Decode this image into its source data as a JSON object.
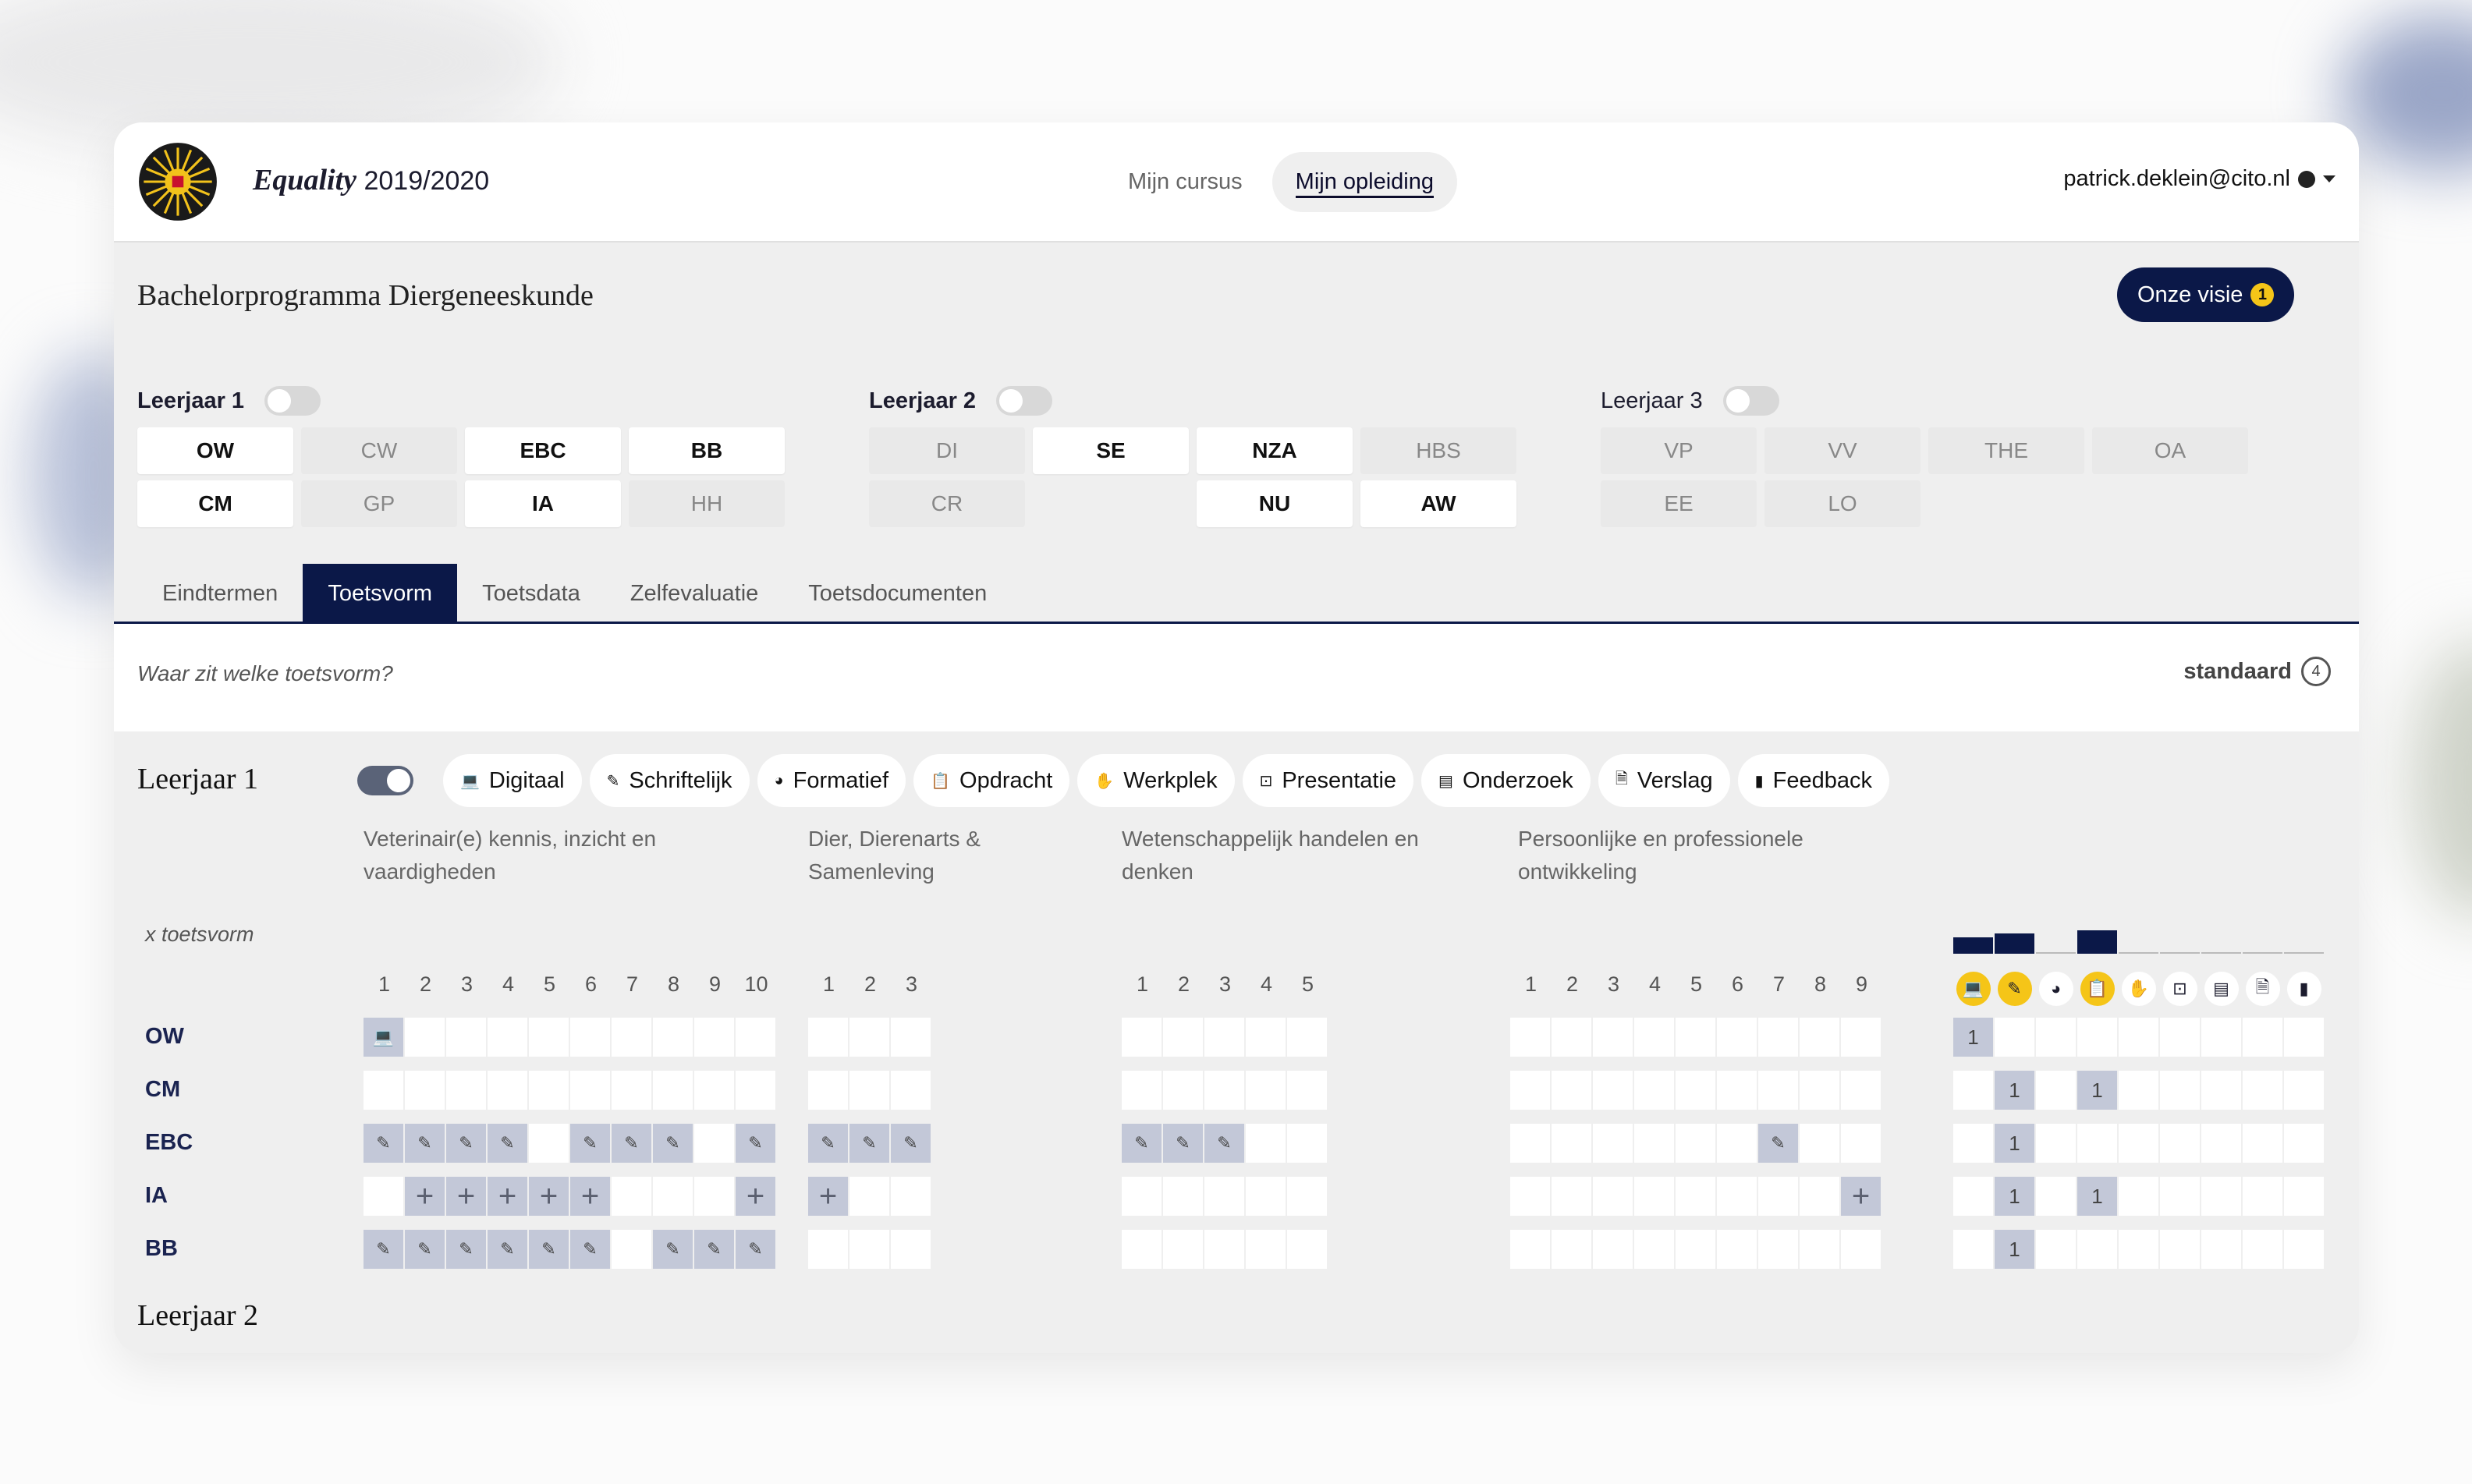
{
  "header": {
    "app_name": "Equality",
    "year": "2019/2020",
    "nav": [
      "Mijn cursus",
      "Mijn opleiding"
    ],
    "user": "patrick.deklein@cito.nl"
  },
  "program": {
    "title": "Bachelorprogramma Diergeneeskunde",
    "vision_label": "Onze visie",
    "vision_badge": "1"
  },
  "years": [
    {
      "label": "Leerjaar 1",
      "courses": [
        [
          "OW",
          "on"
        ],
        [
          "CW",
          "off"
        ],
        [
          "EBC",
          "on"
        ],
        [
          "BB",
          "on"
        ],
        [
          "CM",
          "on"
        ],
        [
          "GP",
          "off"
        ],
        [
          "IA",
          "on"
        ],
        [
          "HH",
          "off"
        ]
      ]
    },
    {
      "label": "Leerjaar 2",
      "courses": [
        [
          "DI",
          "off"
        ],
        [
          "SE",
          "on"
        ],
        [
          "NZA",
          "on"
        ],
        [
          "HBS",
          "off"
        ],
        [
          "CR",
          "off"
        ],
        [
          "",
          "empty"
        ],
        [
          "NU",
          "on"
        ],
        [
          "AW",
          "on"
        ]
      ]
    },
    {
      "label": "Leerjaar 3",
      "courses": [
        [
          "VP",
          "off"
        ],
        [
          "VV",
          "off"
        ],
        [
          "THE",
          "off"
        ],
        [
          "OA",
          "off"
        ],
        [
          "EE",
          "off"
        ],
        [
          "LO",
          "off"
        ]
      ]
    }
  ],
  "tabs": [
    "Eindtermen",
    "Toetsvorm",
    "Toetsdata",
    "Zelfevaluatie",
    "Toetsdocumenten"
  ],
  "question": "Waar zit welke toetsvorm?",
  "standard": {
    "label": "standaard",
    "number": "4"
  },
  "section": {
    "title": "Leerjaar 1",
    "next_title": "Leerjaar 2"
  },
  "filters": [
    {
      "label": "Digitaal",
      "icon": "laptop-icon"
    },
    {
      "label": "Schriftelijk",
      "icon": "pencil-icon"
    },
    {
      "label": "Formatief",
      "icon": "palette-icon"
    },
    {
      "label": "Opdracht",
      "icon": "clipboard-icon"
    },
    {
      "label": "Werkplek",
      "icon": "hand-icon"
    },
    {
      "label": "Presentatie",
      "icon": "presentation-icon"
    },
    {
      "label": "Onderzoek",
      "icon": "table-icon"
    },
    {
      "label": "Verslag",
      "icon": "document-icon"
    },
    {
      "label": "Feedback",
      "icon": "comment-icon"
    }
  ],
  "categories": [
    "Veterinair(e) kennis, inzicht en vaardigheden",
    "Dier, Dierenarts & Samenleving",
    "Wetenschappelijk handelen en denken",
    "Persoonlijke en professionele ontwikkeling"
  ],
  "x_toetsvorm": "x toetsvorm",
  "matrix": {
    "rows": [
      "OW",
      "CM",
      "EBC",
      "IA",
      "BB"
    ],
    "groups": [
      {
        "count": 10,
        "numbers": [
          "1",
          "2",
          "3",
          "4",
          "5",
          "6",
          "7",
          "8",
          "9",
          "10"
        ],
        "cells": [
          [
            "d",
            "",
            "",
            "",
            "",
            "",
            "",
            "",
            "",
            ""
          ],
          [
            "",
            "",
            "",
            "",
            "",
            "",
            "",
            "",
            "",
            ""
          ],
          [
            "s",
            "s",
            "s",
            "s",
            "",
            "s",
            "s",
            "s",
            "",
            "s"
          ],
          [
            "",
            "p",
            "p",
            "p",
            "p",
            "p",
            "",
            "",
            "",
            "p"
          ],
          [
            "s",
            "s",
            "s",
            "s",
            "s",
            "s",
            "",
            "s",
            "s",
            "s"
          ]
        ]
      },
      {
        "count": 3,
        "numbers": [
          "1",
          "2",
          "3"
        ],
        "cells": [
          [
            "",
            "",
            ""
          ],
          [
            "",
            "",
            ""
          ],
          [
            "s",
            "s",
            "s"
          ],
          [
            "p",
            "",
            ""
          ],
          [
            "",
            "",
            ""
          ]
        ]
      },
      {
        "count": 5,
        "numbers": [
          "1",
          "2",
          "3",
          "4",
          "5"
        ],
        "cells": [
          [
            "",
            "",
            "",
            "",
            ""
          ],
          [
            "",
            "",
            "",
            "",
            ""
          ],
          [
            "s",
            "s",
            "s",
            "",
            ""
          ],
          [
            "",
            "",
            "",
            "",
            ""
          ],
          [
            "",
            "",
            "",
            "",
            ""
          ]
        ]
      },
      {
        "count": 9,
        "numbers": [
          "1",
          "2",
          "3",
          "4",
          "5",
          "6",
          "7",
          "8",
          "9"
        ],
        "cells": [
          [
            "",
            "",
            "",
            "",
            "",
            "",
            "",
            "",
            ""
          ],
          [
            "",
            "",
            "",
            "",
            "",
            "",
            "",
            "",
            ""
          ],
          [
            "",
            "",
            "",
            "",
            "",
            "",
            "s",
            "",
            ""
          ],
          [
            "",
            "",
            "",
            "",
            "",
            "",
            "",
            "",
            "p"
          ],
          [
            "",
            "",
            "",
            "",
            "",
            "",
            "",
            "",
            ""
          ]
        ]
      }
    ],
    "summary": [
      [
        "1",
        "",
        "",
        "",
        "",
        "",
        "",
        "",
        ""
      ],
      [
        "",
        "1",
        "",
        "1",
        "",
        "",
        "",
        "",
        ""
      ],
      [
        "",
        "1",
        "",
        "",
        "",
        "",
        "",
        "",
        ""
      ],
      [
        "",
        "1",
        "",
        "1",
        "",
        "",
        "",
        "",
        ""
      ],
      [
        "",
        "1",
        "",
        "",
        "",
        "",
        "",
        "",
        ""
      ]
    ],
    "summary_bar_values": [
      1,
      1.2,
      0,
      1.4,
      0,
      0,
      0,
      0,
      0
    ],
    "summary_icons": [
      {
        "name": "laptop-icon",
        "highlight": true
      },
      {
        "name": "pencil-icon",
        "highlight": true
      },
      {
        "name": "palette-icon",
        "highlight": false
      },
      {
        "name": "clipboard-icon",
        "highlight": true
      },
      {
        "name": "hand-icon",
        "highlight": false
      },
      {
        "name": "presentation-icon",
        "highlight": false
      },
      {
        "name": "table-icon",
        "highlight": false
      },
      {
        "name": "document-icon",
        "highlight": false
      },
      {
        "name": "comment-icon",
        "highlight": false
      }
    ],
    "cell_glyphs": {
      "d": "💻",
      "s": "✎",
      "p": "+"
    }
  },
  "icon_glyphs": {
    "laptop-icon": "💻",
    "pencil-icon": "✎",
    "palette-icon": "◕",
    "clipboard-icon": "📋",
    "hand-icon": "✋",
    "presentation-icon": "⊡",
    "table-icon": "▤",
    "document-icon": "🗎",
    "comment-icon": "▮"
  }
}
